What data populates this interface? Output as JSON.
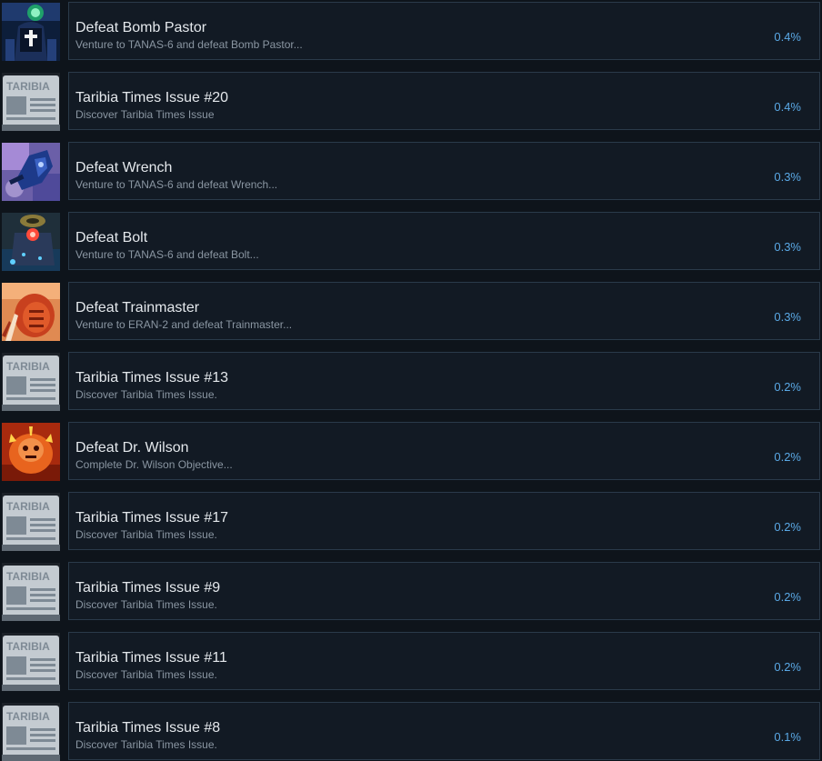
{
  "achievements": [
    {
      "title": "Defeat Bomb Pastor",
      "description": "Venture to TANAS-6 and defeat Bomb Pastor...",
      "percent": "0.4%",
      "icon": "bomb-pastor-icon"
    },
    {
      "title": "Taribia Times Issue #20",
      "description": "Discover Taribia Times Issue",
      "percent": "0.4%",
      "icon": "taribia-newspaper-icon",
      "icon_text": "TARIBIA"
    },
    {
      "title": "Defeat Wrench",
      "description": "Venture to TANAS-6 and defeat Wrench...",
      "percent": "0.3%",
      "icon": "wrench-boss-icon"
    },
    {
      "title": "Defeat Bolt",
      "description": "Venture to TANAS-6 and defeat Bolt...",
      "percent": "0.3%",
      "icon": "bolt-boss-icon"
    },
    {
      "title": "Defeat Trainmaster",
      "description": "Venture to ERAN-2 and defeat Trainmaster...",
      "percent": "0.3%",
      "icon": "trainmaster-icon"
    },
    {
      "title": "Taribia Times Issue #13",
      "description": "Discover Taribia Times Issue.",
      "percent": "0.2%",
      "icon": "taribia-newspaper-icon",
      "icon_text": "TARIBIA"
    },
    {
      "title": "Defeat Dr. Wilson",
      "description": "Complete Dr. Wilson Objective...",
      "percent": "0.2%",
      "icon": "dr-wilson-icon"
    },
    {
      "title": "Taribia Times Issue #17",
      "description": "Discover Taribia Times Issue.",
      "percent": "0.2%",
      "icon": "taribia-newspaper-icon",
      "icon_text": "TARIBIA"
    },
    {
      "title": "Taribia Times Issue #9",
      "description": "Discover Taribia Times Issue.",
      "percent": "0.2%",
      "icon": "taribia-newspaper-icon",
      "icon_text": "TARIBIA"
    },
    {
      "title": "Taribia Times Issue #11",
      "description": "Discover Taribia Times Issue.",
      "percent": "0.2%",
      "icon": "taribia-newspaper-icon",
      "icon_text": "TARIBIA"
    },
    {
      "title": "Taribia Times Issue #8",
      "description": "Discover Taribia Times Issue.",
      "percent": "0.1%",
      "icon": "taribia-newspaper-icon",
      "icon_text": "TARIBIA"
    }
  ],
  "colors": {
    "background": "#0e141b",
    "panel": "#121a24",
    "panel_border": "#2a3a4a",
    "title": "#e4e8ec",
    "description": "#8a96a2",
    "percent": "#5aa9e6"
  }
}
